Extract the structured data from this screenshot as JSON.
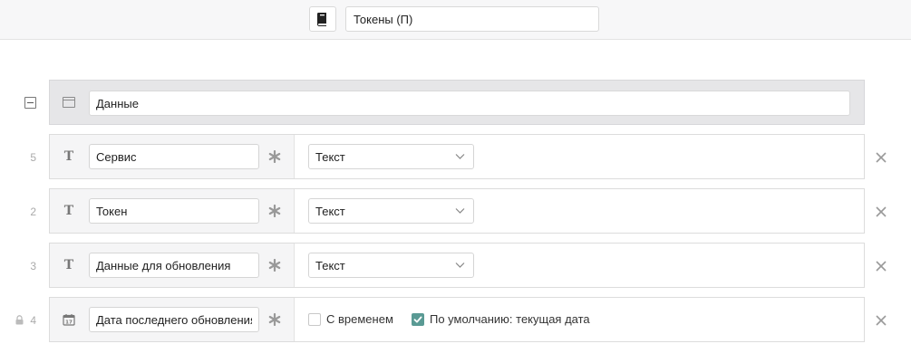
{
  "header": {
    "book_icon": "book-icon",
    "title_value": "Токены (П)"
  },
  "group": {
    "collapse_icon": "collapse-minus-icon",
    "icon": "window-icon",
    "name_value": "Данные"
  },
  "fields": [
    {
      "number": "5",
      "type_icon": "text-type-icon",
      "name_value": "Сервис",
      "type_label": "Текст"
    },
    {
      "number": "2",
      "type_icon": "text-type-icon",
      "name_value": "Токен",
      "type_label": "Текст"
    },
    {
      "number": "3",
      "type_icon": "text-type-icon",
      "name_value": "Данные для обновления",
      "type_label": "Текст"
    },
    {
      "number": "4",
      "locked": true,
      "type_icon": "calendar-icon",
      "name_value": "Дата последнего обновления",
      "with_time_label": "С временем",
      "with_time_checked": false,
      "default_today_label": "По умолчанию: текущая дата",
      "default_today_checked": true
    }
  ],
  "colors": {
    "checkbox_accent": "#5a9a94",
    "group_bg": "#e6e6e8"
  }
}
